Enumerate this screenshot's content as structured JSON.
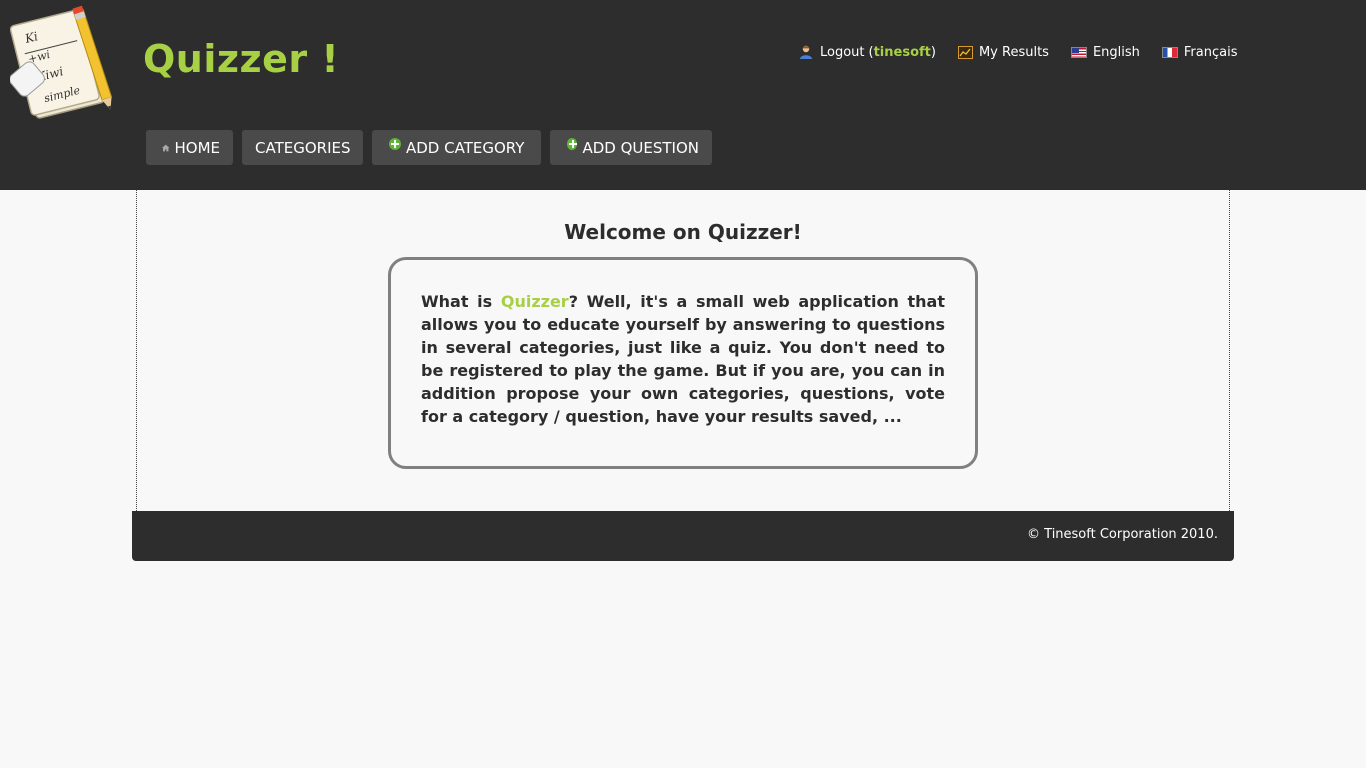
{
  "app": {
    "title": "Quizzer !",
    "logo_icon": "notepad-pencil-icon"
  },
  "user_links": {
    "logout_label": "Logout",
    "logout_paren_open": "(",
    "username": "tinesoft",
    "logout_paren_close": ")",
    "my_results_label": "My Results",
    "english_label": "English",
    "francais_label": "Français"
  },
  "nav": {
    "home_label": "HOME",
    "categories_label": "CATEGORIES",
    "add_category_label": "ADD CATEGORY",
    "add_question_label": "ADD QUESTION"
  },
  "main": {
    "welcome_title": "Welcome on Quizzer!",
    "intro_prefix": "What is ",
    "intro_highlight": "Quizzer",
    "intro_rest": "? Well, it's a small web application that allows you to educate yourself by answering to questions in several categories, just like a quiz. You don't need to be registered to play the game. But if you are, you can in addition propose your own categories, questions, vote for a category / question, have your results saved, ..."
  },
  "footer": {
    "copyright": "© Tinesoft Corporation 2010."
  },
  "colors": {
    "header_bg": "#2d2d2d",
    "accent_green": "#a8d045",
    "nav_button_bg": "#4a4a4a",
    "page_bg": "#f8f8f8"
  }
}
